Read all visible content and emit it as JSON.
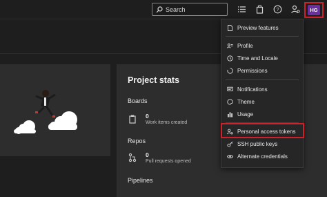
{
  "topbar": {
    "search_placeholder": "Search",
    "icons": [
      "search-icon",
      "list-icon",
      "bag-icon",
      "help-icon",
      "user-settings-icon"
    ],
    "avatar_initials": "HG",
    "avatar_color": "#6b2fa0",
    "highlight_color": "#d2202a"
  },
  "project_stats": {
    "title": "Project stats",
    "boards": {
      "label": "Boards",
      "value": "0",
      "caption": "Work items created"
    },
    "repos": {
      "label": "Repos",
      "value": "0",
      "caption": "Pull requests opened"
    },
    "pipelines": {
      "label": "Pipelines"
    }
  },
  "user_menu": {
    "items": [
      {
        "label": "Preview features",
        "icon": "document-icon"
      },
      {
        "label": "Profile",
        "icon": "profile-card-icon"
      },
      {
        "label": "Time and Locale",
        "icon": "clock-icon"
      },
      {
        "label": "Permissions",
        "icon": "permissions-icon"
      },
      {
        "label": "Notifications",
        "icon": "notifications-icon"
      },
      {
        "label": "Theme",
        "icon": "palette-icon"
      },
      {
        "label": "Usage",
        "icon": "bar-chart-icon"
      },
      {
        "label": "Personal access tokens",
        "icon": "user-key-icon"
      },
      {
        "label": "SSH public keys",
        "icon": "key-icon"
      },
      {
        "label": "Alternate credentials",
        "icon": "eye-icon"
      }
    ],
    "highlighted": "Personal access tokens"
  }
}
